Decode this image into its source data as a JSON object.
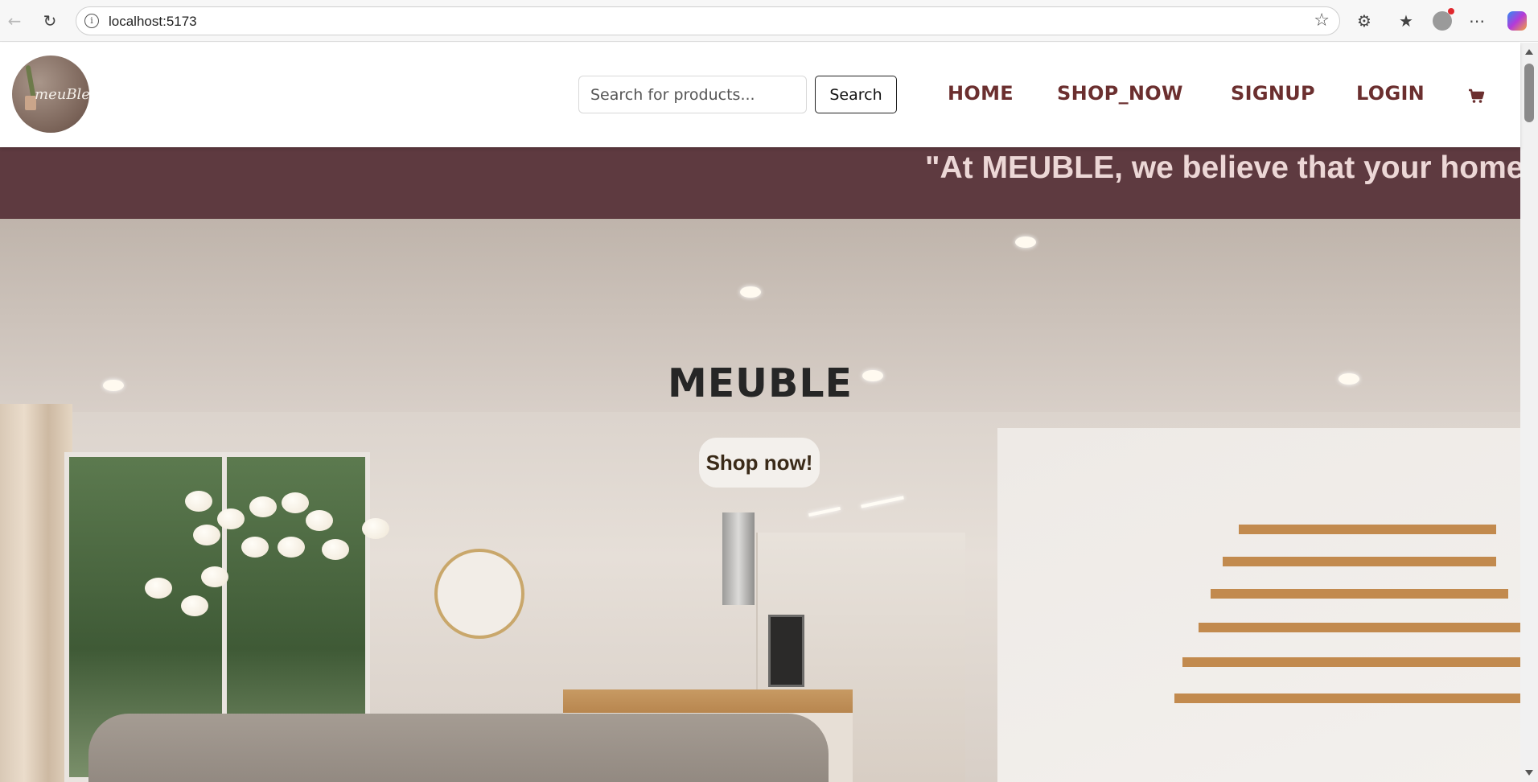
{
  "browser": {
    "url": "localhost:5173"
  },
  "header": {
    "logo_text": "meuBle",
    "search": {
      "placeholder": "Search for products...",
      "button_label": "Search"
    },
    "nav": [
      {
        "label": "HOME"
      },
      {
        "label": "SHOP_NOW"
      },
      {
        "label": "SIGNUP"
      },
      {
        "label": "LOGIN"
      }
    ],
    "cart_icon": "cart-icon"
  },
  "marquee": {
    "text": "\"At MEUBLE, we believe that your home d"
  },
  "hero": {
    "title": "MEUBLE",
    "button_label": "Shop now!"
  },
  "colors": {
    "nav_link": "#6b2f2f",
    "marquee_bg": "#5e3a40",
    "marquee_text": "#ecd7d6"
  }
}
